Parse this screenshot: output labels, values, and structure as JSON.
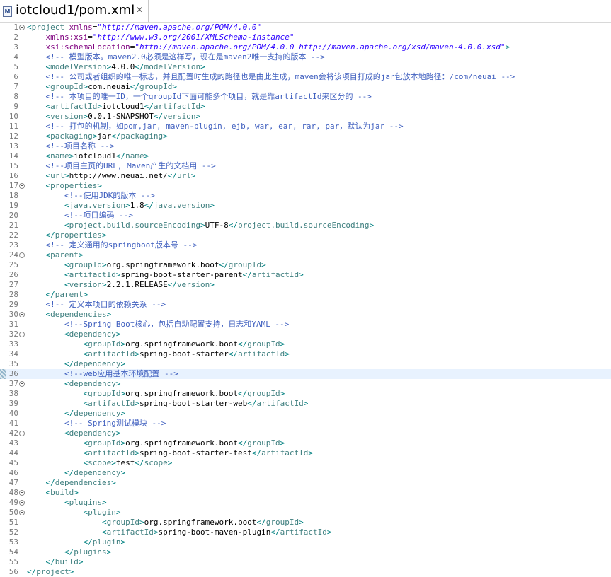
{
  "editor_tab": {
    "title": "iotcloud1/pom.xml",
    "icon": "xml-file-icon",
    "close_glyph": "✕"
  },
  "current_line": 36,
  "colors": {
    "bracket": "#008080",
    "tag": "#3f7f7f",
    "attr": "#7f007f",
    "value": "#2a00ff",
    "comment": "#3f5fbf",
    "text": "#000000",
    "current_line_bg": "#e8f2fe"
  },
  "lines": [
    {
      "n": 1,
      "fold": true,
      "tokens": [
        [
          "b",
          "<"
        ],
        [
          "t",
          "project"
        ],
        [
          "x",
          " "
        ],
        [
          "a",
          "xmlns"
        ],
        [
          "x",
          "="
        ],
        [
          "v",
          "\"http://maven.apache.org/POM/4.0.0\""
        ]
      ]
    },
    {
      "n": 2,
      "tokens": [
        [
          "x",
          "    "
        ],
        [
          "a",
          "xmlns:xsi"
        ],
        [
          "x",
          "="
        ],
        [
          "v",
          "\"http://www.w3.org/2001/XMLSchema-instance\""
        ]
      ]
    },
    {
      "n": 3,
      "tokens": [
        [
          "x",
          "    "
        ],
        [
          "a",
          "xsi:schemaLocation"
        ],
        [
          "x",
          "="
        ],
        [
          "v",
          "\"http://maven.apache.org/POM/4.0.0 http://maven.apache.org/xsd/maven-4.0.0.xsd\""
        ],
        [
          "b",
          ">"
        ]
      ]
    },
    {
      "n": 4,
      "tokens": [
        [
          "x",
          "    "
        ],
        [
          "c",
          "<!-- 模型版本。maven2.0必须是这样写，现在是maven2唯一支持的版本 -->"
        ]
      ]
    },
    {
      "n": 5,
      "tokens": [
        [
          "x",
          "    "
        ],
        [
          "b",
          "<"
        ],
        [
          "t",
          "modelVersion"
        ],
        [
          "b",
          ">"
        ],
        [
          "x",
          "4.0.0"
        ],
        [
          "b",
          "</"
        ],
        [
          "t",
          "modelVersion"
        ],
        [
          "b",
          ">"
        ]
      ]
    },
    {
      "n": 6,
      "tokens": [
        [
          "x",
          "    "
        ],
        [
          "c",
          "<!-- 公司或者组织的唯一标志，并且配置时生成的路径也是由此生成，maven会将该项目打成的jar包放本地路径：/com/neuai -->"
        ]
      ]
    },
    {
      "n": 7,
      "tokens": [
        [
          "x",
          "    "
        ],
        [
          "b",
          "<"
        ],
        [
          "t",
          "groupId"
        ],
        [
          "b",
          ">"
        ],
        [
          "x",
          "com.neuai"
        ],
        [
          "b",
          "</"
        ],
        [
          "t",
          "groupId"
        ],
        [
          "b",
          ">"
        ]
      ]
    },
    {
      "n": 8,
      "tokens": [
        [
          "x",
          "    "
        ],
        [
          "c",
          "<!-- 本项目的唯一ID，一个groupId下面可能多个项目，就是靠artifactId来区分的 -->"
        ]
      ]
    },
    {
      "n": 9,
      "tokens": [
        [
          "x",
          "    "
        ],
        [
          "b",
          "<"
        ],
        [
          "t",
          "artifactId"
        ],
        [
          "b",
          ">"
        ],
        [
          "x",
          "iotcloud1"
        ],
        [
          "b",
          "</"
        ],
        [
          "t",
          "artifactId"
        ],
        [
          "b",
          ">"
        ]
      ]
    },
    {
      "n": 10,
      "tokens": [
        [
          "x",
          "    "
        ],
        [
          "b",
          "<"
        ],
        [
          "t",
          "version"
        ],
        [
          "b",
          ">"
        ],
        [
          "x",
          "0.0.1-SNAPSHOT"
        ],
        [
          "b",
          "</"
        ],
        [
          "t",
          "version"
        ],
        [
          "b",
          ">"
        ]
      ]
    },
    {
      "n": 11,
      "tokens": [
        [
          "x",
          "    "
        ],
        [
          "c",
          "<!-- 打包的机制，如pom,jar, maven-plugin, ejb, war, ear, rar, par，默认为jar -->"
        ]
      ]
    },
    {
      "n": 12,
      "tokens": [
        [
          "x",
          "    "
        ],
        [
          "b",
          "<"
        ],
        [
          "t",
          "packaging"
        ],
        [
          "b",
          ">"
        ],
        [
          "x",
          "jar"
        ],
        [
          "b",
          "</"
        ],
        [
          "t",
          "packaging"
        ],
        [
          "b",
          ">"
        ]
      ]
    },
    {
      "n": 13,
      "tokens": [
        [
          "x",
          "    "
        ],
        [
          "c",
          "<!--项目名称 -->"
        ]
      ]
    },
    {
      "n": 14,
      "tokens": [
        [
          "x",
          "    "
        ],
        [
          "b",
          "<"
        ],
        [
          "t",
          "name"
        ],
        [
          "b",
          ">"
        ],
        [
          "x",
          "iotcloud1"
        ],
        [
          "b",
          "</"
        ],
        [
          "t",
          "name"
        ],
        [
          "b",
          ">"
        ]
      ]
    },
    {
      "n": 15,
      "tokens": [
        [
          "x",
          "    "
        ],
        [
          "c",
          "<!--项目主页的URL, Maven产生的文档用 -->"
        ]
      ]
    },
    {
      "n": 16,
      "tokens": [
        [
          "x",
          "    "
        ],
        [
          "b",
          "<"
        ],
        [
          "t",
          "url"
        ],
        [
          "b",
          ">"
        ],
        [
          "x",
          "http://www.neuai.net/"
        ],
        [
          "b",
          "</"
        ],
        [
          "t",
          "url"
        ],
        [
          "b",
          ">"
        ]
      ]
    },
    {
      "n": 17,
      "fold": true,
      "tokens": [
        [
          "x",
          "    "
        ],
        [
          "b",
          "<"
        ],
        [
          "t",
          "properties"
        ],
        [
          "b",
          ">"
        ]
      ]
    },
    {
      "n": 18,
      "tokens": [
        [
          "x",
          "        "
        ],
        [
          "c",
          "<!--使用JDK的版本 -->"
        ]
      ]
    },
    {
      "n": 19,
      "tokens": [
        [
          "x",
          "        "
        ],
        [
          "b",
          "<"
        ],
        [
          "t",
          "java.version"
        ],
        [
          "b",
          ">"
        ],
        [
          "x",
          "1.8"
        ],
        [
          "b",
          "</"
        ],
        [
          "t",
          "java.version"
        ],
        [
          "b",
          ">"
        ]
      ]
    },
    {
      "n": 20,
      "tokens": [
        [
          "x",
          "        "
        ],
        [
          "c",
          "<!--项目编码 -->"
        ]
      ]
    },
    {
      "n": 21,
      "tokens": [
        [
          "x",
          "        "
        ],
        [
          "b",
          "<"
        ],
        [
          "t",
          "project.build.sourceEncoding"
        ],
        [
          "b",
          ">"
        ],
        [
          "x",
          "UTF-8"
        ],
        [
          "b",
          "</"
        ],
        [
          "t",
          "project.build.sourceEncoding"
        ],
        [
          "b",
          ">"
        ]
      ]
    },
    {
      "n": 22,
      "tokens": [
        [
          "x",
          "    "
        ],
        [
          "b",
          "</"
        ],
        [
          "t",
          "properties"
        ],
        [
          "b",
          ">"
        ]
      ]
    },
    {
      "n": 23,
      "tokens": [
        [
          "x",
          "    "
        ],
        [
          "c",
          "<!-- 定义通用的springboot版本号 -->"
        ]
      ]
    },
    {
      "n": 24,
      "fold": true,
      "tokens": [
        [
          "x",
          "    "
        ],
        [
          "b",
          "<"
        ],
        [
          "t",
          "parent"
        ],
        [
          "b",
          ">"
        ]
      ]
    },
    {
      "n": 25,
      "tokens": [
        [
          "x",
          "        "
        ],
        [
          "b",
          "<"
        ],
        [
          "t",
          "groupId"
        ],
        [
          "b",
          ">"
        ],
        [
          "x",
          "org.springframework.boot"
        ],
        [
          "b",
          "</"
        ],
        [
          "t",
          "groupId"
        ],
        [
          "b",
          ">"
        ]
      ]
    },
    {
      "n": 26,
      "tokens": [
        [
          "x",
          "        "
        ],
        [
          "b",
          "<"
        ],
        [
          "t",
          "artifactId"
        ],
        [
          "b",
          ">"
        ],
        [
          "x",
          "spring-boot-starter-parent"
        ],
        [
          "b",
          "</"
        ],
        [
          "t",
          "artifactId"
        ],
        [
          "b",
          ">"
        ]
      ]
    },
    {
      "n": 27,
      "tokens": [
        [
          "x",
          "        "
        ],
        [
          "b",
          "<"
        ],
        [
          "t",
          "version"
        ],
        [
          "b",
          ">"
        ],
        [
          "x",
          "2.2.1.RELEASE"
        ],
        [
          "b",
          "</"
        ],
        [
          "t",
          "version"
        ],
        [
          "b",
          ">"
        ]
      ]
    },
    {
      "n": 28,
      "tokens": [
        [
          "x",
          "    "
        ],
        [
          "b",
          "</"
        ],
        [
          "t",
          "parent"
        ],
        [
          "b",
          ">"
        ]
      ]
    },
    {
      "n": 29,
      "tokens": [
        [
          "x",
          "    "
        ],
        [
          "c",
          "<!-- 定义本项目的依赖关系 -->"
        ]
      ]
    },
    {
      "n": 30,
      "fold": true,
      "tokens": [
        [
          "x",
          "    "
        ],
        [
          "b",
          "<"
        ],
        [
          "t",
          "dependencies"
        ],
        [
          "b",
          ">"
        ]
      ]
    },
    {
      "n": 31,
      "tokens": [
        [
          "x",
          "        "
        ],
        [
          "c",
          "<!--Spring Boot核心，包括自动配置支持，日志和YAML -->"
        ]
      ]
    },
    {
      "n": 32,
      "fold": true,
      "tokens": [
        [
          "x",
          "        "
        ],
        [
          "b",
          "<"
        ],
        [
          "t",
          "dependency"
        ],
        [
          "b",
          ">"
        ]
      ]
    },
    {
      "n": 33,
      "tokens": [
        [
          "x",
          "            "
        ],
        [
          "b",
          "<"
        ],
        [
          "t",
          "groupId"
        ],
        [
          "b",
          ">"
        ],
        [
          "x",
          "org.springframework.boot"
        ],
        [
          "b",
          "</"
        ],
        [
          "t",
          "groupId"
        ],
        [
          "b",
          ">"
        ]
      ]
    },
    {
      "n": 34,
      "tokens": [
        [
          "x",
          "            "
        ],
        [
          "b",
          "<"
        ],
        [
          "t",
          "artifactId"
        ],
        [
          "b",
          ">"
        ],
        [
          "x",
          "spring-boot-starter"
        ],
        [
          "b",
          "</"
        ],
        [
          "t",
          "artifactId"
        ],
        [
          "b",
          ">"
        ]
      ]
    },
    {
      "n": 35,
      "tokens": [
        [
          "x",
          "        "
        ],
        [
          "b",
          "</"
        ],
        [
          "t",
          "dependency"
        ],
        [
          "b",
          ">"
        ]
      ]
    },
    {
      "n": 36,
      "tokens": [
        [
          "x",
          "        "
        ],
        [
          "c",
          "<!--web应用基本环境配置 -->"
        ]
      ]
    },
    {
      "n": 37,
      "fold": true,
      "tokens": [
        [
          "x",
          "        "
        ],
        [
          "b",
          "<"
        ],
        [
          "t",
          "dependency"
        ],
        [
          "b",
          ">"
        ]
      ]
    },
    {
      "n": 38,
      "tokens": [
        [
          "x",
          "            "
        ],
        [
          "b",
          "<"
        ],
        [
          "t",
          "groupId"
        ],
        [
          "b",
          ">"
        ],
        [
          "x",
          "org.springframework.boot"
        ],
        [
          "b",
          "</"
        ],
        [
          "t",
          "groupId"
        ],
        [
          "b",
          ">"
        ]
      ]
    },
    {
      "n": 39,
      "tokens": [
        [
          "x",
          "            "
        ],
        [
          "b",
          "<"
        ],
        [
          "t",
          "artifactId"
        ],
        [
          "b",
          ">"
        ],
        [
          "x",
          "spring-boot-starter-web"
        ],
        [
          "b",
          "</"
        ],
        [
          "t",
          "artifactId"
        ],
        [
          "b",
          ">"
        ]
      ]
    },
    {
      "n": 40,
      "tokens": [
        [
          "x",
          "        "
        ],
        [
          "b",
          "</"
        ],
        [
          "t",
          "dependency"
        ],
        [
          "b",
          ">"
        ]
      ]
    },
    {
      "n": 41,
      "tokens": [
        [
          "x",
          "        "
        ],
        [
          "c",
          "<!-- Spring测试模块 -->"
        ]
      ]
    },
    {
      "n": 42,
      "fold": true,
      "tokens": [
        [
          "x",
          "        "
        ],
        [
          "b",
          "<"
        ],
        [
          "t",
          "dependency"
        ],
        [
          "b",
          ">"
        ]
      ]
    },
    {
      "n": 43,
      "tokens": [
        [
          "x",
          "            "
        ],
        [
          "b",
          "<"
        ],
        [
          "t",
          "groupId"
        ],
        [
          "b",
          ">"
        ],
        [
          "x",
          "org.springframework.boot"
        ],
        [
          "b",
          "</"
        ],
        [
          "t",
          "groupId"
        ],
        [
          "b",
          ">"
        ]
      ]
    },
    {
      "n": 44,
      "tokens": [
        [
          "x",
          "            "
        ],
        [
          "b",
          "<"
        ],
        [
          "t",
          "artifactId"
        ],
        [
          "b",
          ">"
        ],
        [
          "x",
          "spring-boot-starter-test"
        ],
        [
          "b",
          "</"
        ],
        [
          "t",
          "artifactId"
        ],
        [
          "b",
          ">"
        ]
      ]
    },
    {
      "n": 45,
      "tokens": [
        [
          "x",
          "            "
        ],
        [
          "b",
          "<"
        ],
        [
          "t",
          "scope"
        ],
        [
          "b",
          ">"
        ],
        [
          "x",
          "test"
        ],
        [
          "b",
          "</"
        ],
        [
          "t",
          "scope"
        ],
        [
          "b",
          ">"
        ]
      ]
    },
    {
      "n": 46,
      "tokens": [
        [
          "x",
          "        "
        ],
        [
          "b",
          "</"
        ],
        [
          "t",
          "dependency"
        ],
        [
          "b",
          ">"
        ]
      ]
    },
    {
      "n": 47,
      "tokens": [
        [
          "x",
          "    "
        ],
        [
          "b",
          "</"
        ],
        [
          "t",
          "dependencies"
        ],
        [
          "b",
          ">"
        ]
      ]
    },
    {
      "n": 48,
      "fold": true,
      "tokens": [
        [
          "x",
          "    "
        ],
        [
          "b",
          "<"
        ],
        [
          "t",
          "build"
        ],
        [
          "b",
          ">"
        ]
      ]
    },
    {
      "n": 49,
      "fold": true,
      "tokens": [
        [
          "x",
          "        "
        ],
        [
          "b",
          "<"
        ],
        [
          "t",
          "plugins"
        ],
        [
          "b",
          ">"
        ]
      ]
    },
    {
      "n": 50,
      "fold": true,
      "tokens": [
        [
          "x",
          "            "
        ],
        [
          "b",
          "<"
        ],
        [
          "t",
          "plugin"
        ],
        [
          "b",
          ">"
        ]
      ]
    },
    {
      "n": 51,
      "tokens": [
        [
          "x",
          "                "
        ],
        [
          "b",
          "<"
        ],
        [
          "t",
          "groupId"
        ],
        [
          "b",
          ">"
        ],
        [
          "x",
          "org.springframework.boot"
        ],
        [
          "b",
          "</"
        ],
        [
          "t",
          "groupId"
        ],
        [
          "b",
          ">"
        ]
      ]
    },
    {
      "n": 52,
      "tokens": [
        [
          "x",
          "                "
        ],
        [
          "b",
          "<"
        ],
        [
          "t",
          "artifactId"
        ],
        [
          "b",
          ">"
        ],
        [
          "x",
          "spring-boot-maven-plugin"
        ],
        [
          "b",
          "</"
        ],
        [
          "t",
          "artifactId"
        ],
        [
          "b",
          ">"
        ]
      ]
    },
    {
      "n": 53,
      "tokens": [
        [
          "x",
          "            "
        ],
        [
          "b",
          "</"
        ],
        [
          "t",
          "plugin"
        ],
        [
          "b",
          ">"
        ]
      ]
    },
    {
      "n": 54,
      "tokens": [
        [
          "x",
          "        "
        ],
        [
          "b",
          "</"
        ],
        [
          "t",
          "plugins"
        ],
        [
          "b",
          ">"
        ]
      ]
    },
    {
      "n": 55,
      "tokens": [
        [
          "x",
          "    "
        ],
        [
          "b",
          "</"
        ],
        [
          "t",
          "build"
        ],
        [
          "b",
          ">"
        ]
      ]
    },
    {
      "n": 56,
      "tokens": [
        [
          "b",
          "</"
        ],
        [
          "t",
          "project"
        ],
        [
          "b",
          ">"
        ]
      ]
    }
  ]
}
